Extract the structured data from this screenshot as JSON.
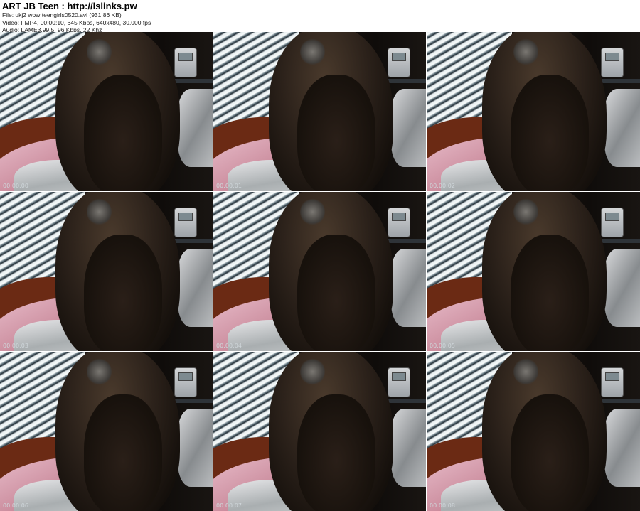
{
  "header": {
    "title": "ART JB Teen : http://lslinks.pw",
    "file_line": "File: ukj2 wow teengirls0520.avi (931.86 KB)",
    "video_line": "Video: FMP4, 00:00:10, 645 Kbps, 640x480, 30.000 fps",
    "audio_line": "Audio: LAME3.99.5, 96 Kbps, 22 Khz"
  },
  "thumbnails": [
    {
      "timecode": "00:00:00"
    },
    {
      "timecode": "00:00:01"
    },
    {
      "timecode": "00:00:02"
    },
    {
      "timecode": "00:00:03"
    },
    {
      "timecode": "00:00:04"
    },
    {
      "timecode": "00:00:05"
    },
    {
      "timecode": "00:00:06"
    },
    {
      "timecode": "00:00:07"
    },
    {
      "timecode": "00:00:08"
    }
  ]
}
